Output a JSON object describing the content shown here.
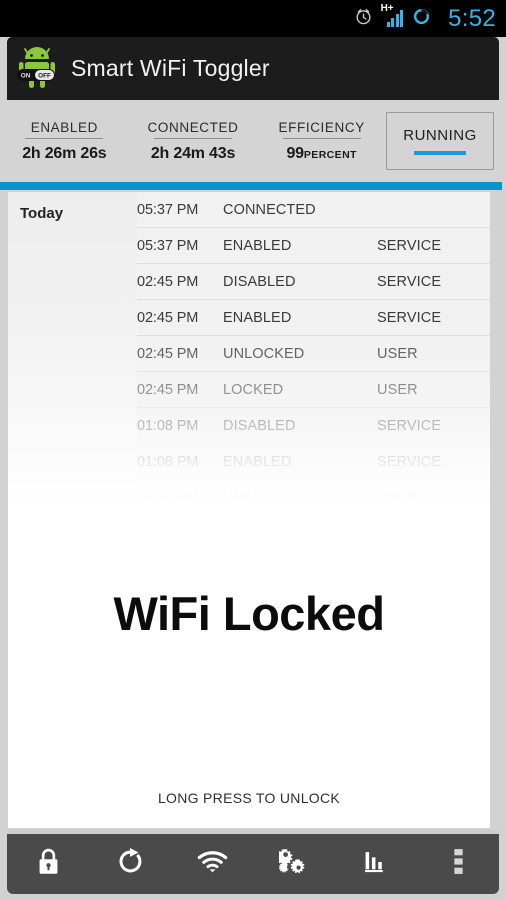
{
  "status_bar": {
    "time": "5:52",
    "network_type": "H+",
    "icons": [
      "alarm-clock-icon",
      "signal-bars-icon",
      "sync-circle-icon"
    ],
    "accent_color": "#33b5e5"
  },
  "action_bar": {
    "title": "Smart WiFi Toggler",
    "app_icon": "android-onoff-icon",
    "icon_badge_on": "ON",
    "icon_badge_off": "OFF",
    "background_color": "#1c1c1c"
  },
  "stats": {
    "items": [
      {
        "label": "ENABLED",
        "value": "2h 26m 26s",
        "unit": ""
      },
      {
        "label": "CONNECTED",
        "value": "2h 24m 43s",
        "unit": ""
      },
      {
        "label": "EFFICIENCY",
        "value": "99",
        "unit": "PERCENT"
      }
    ],
    "service_button": {
      "label": "RUNNING",
      "indicator_color": "#1a9cd8"
    },
    "divider_color": "#0d91cc"
  },
  "log": {
    "group_label": "Today",
    "columns": [
      "time",
      "event",
      "source"
    ],
    "rows": [
      {
        "time": "05:37 PM",
        "event": "CONNECTED",
        "source": ""
      },
      {
        "time": "05:37 PM",
        "event": "ENABLED",
        "source": "SERVICE"
      },
      {
        "time": "02:45 PM",
        "event": "DISABLED",
        "source": "SERVICE"
      },
      {
        "time": "02:45 PM",
        "event": "ENABLED",
        "source": "SERVICE"
      },
      {
        "time": "02:45 PM",
        "event": "UNLOCKED",
        "source": "USER"
      },
      {
        "time": "02:45 PM",
        "event": "LOCKED",
        "source": "USER"
      },
      {
        "time": "01:08 PM",
        "event": "DISABLED",
        "source": "SERVICE"
      },
      {
        "time": "01:08 PM",
        "event": "ENABLED",
        "source": "SERVICE"
      },
      {
        "time": "01:08 PM",
        "event": "UNLOCKED",
        "source": "USER"
      }
    ]
  },
  "locked": {
    "title": "WiFi Locked",
    "hint": "LONG PRESS TO UNLOCK"
  },
  "toolbar": {
    "background_color": "#4a4a4a",
    "buttons": [
      {
        "name": "lock-icon",
        "label": "Lock"
      },
      {
        "name": "refresh-icon",
        "label": "Refresh"
      },
      {
        "name": "wifi-icon",
        "label": "WiFi"
      },
      {
        "name": "gears-icon",
        "label": "Settings"
      },
      {
        "name": "bar-chart-icon",
        "label": "Statistics"
      },
      {
        "name": "overflow-menu-icon",
        "label": "More options"
      }
    ]
  }
}
